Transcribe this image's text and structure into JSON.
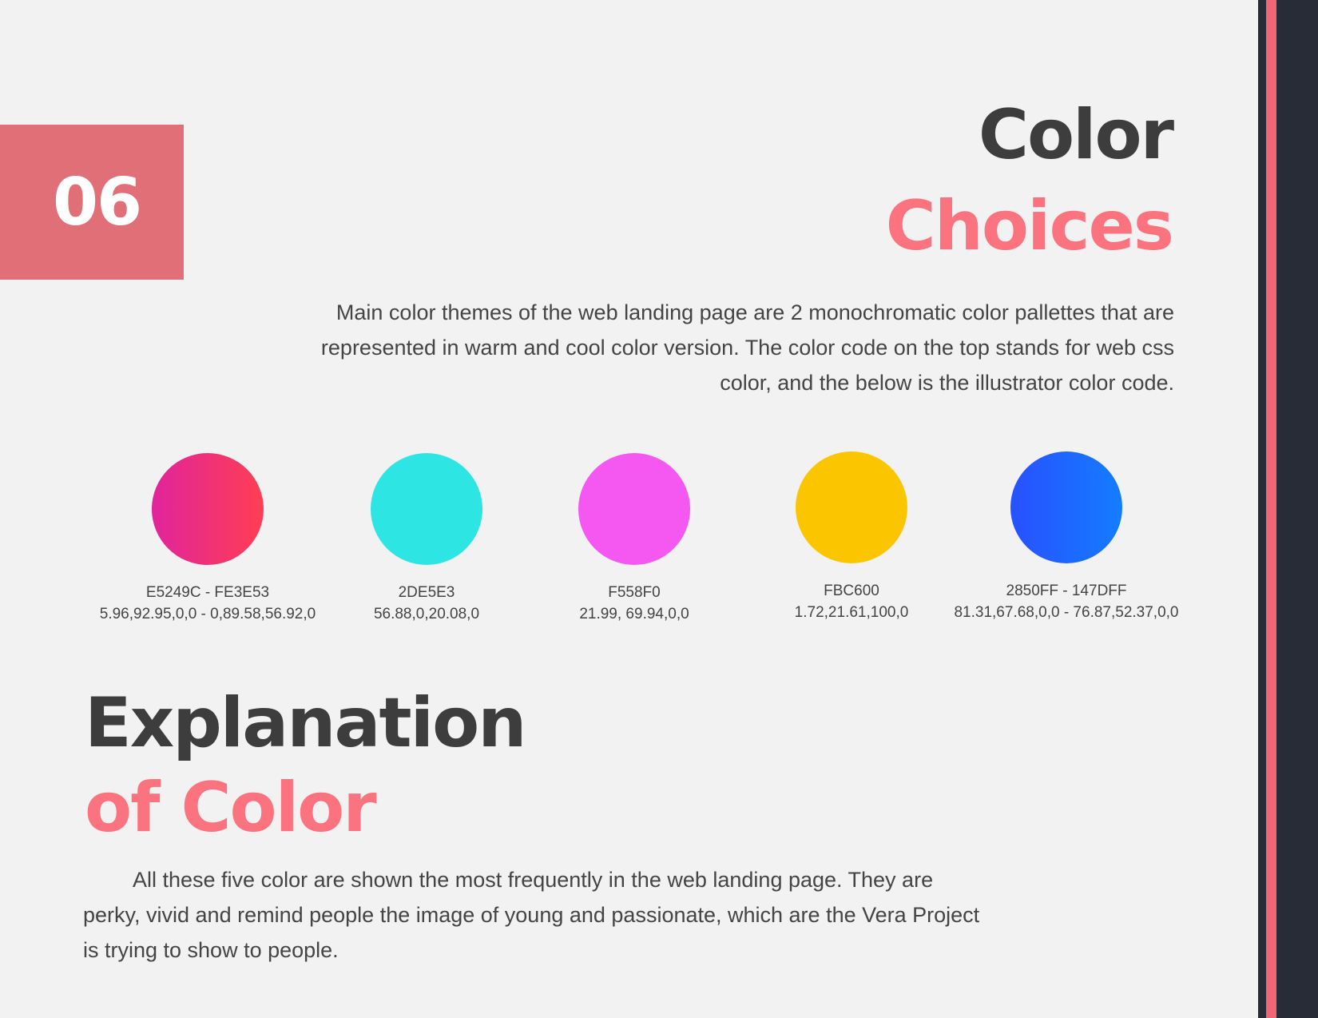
{
  "page_number": "06",
  "header": {
    "title_line1": "Color",
    "title_line2": "Choices"
  },
  "intro": "Main color themes of the web landing page are 2 monochromatic color pallettes that are represented in warm and cool color version. The color code on the top stands for web css color, and the below is the illustrator color code.",
  "swatches": [
    {
      "hex": "E5249C - FE3E53",
      "cmyk": "5.96,92.95,0,0 - 0,89.58,56.92,0",
      "colors": [
        "#E0249C",
        "#FE3E53"
      ]
    },
    {
      "hex": "2DE5E3",
      "cmyk": "56.88,0,20.08,0",
      "colors": [
        "#2DE5E3"
      ]
    },
    {
      "hex": "F558F0",
      "cmyk": "21.99, 69.94,0,0",
      "colors": [
        "#F558F0"
      ]
    },
    {
      "hex": "FBC600",
      "cmyk": "1.72,21.61,100,0",
      "colors": [
        "#FBC600"
      ]
    },
    {
      "hex": "2850FF - 147DFF",
      "cmyk": "81.31,67.68,0,0 - 76.87,52.37,0,0",
      "colors": [
        "#2850FF",
        "#147DFF"
      ]
    }
  ],
  "explanation": {
    "title_line1": "Explanation",
    "title_line2": "of Color",
    "body": "All these five color are shown the most frequently in the web landing page. They are perky, vivid and remind people the image of young and passionate, which are the Vera Project is trying to show to people."
  },
  "colors": {
    "background": "#F2F2F2",
    "accent_pink": "#FA737F",
    "number_box": "#E06F78",
    "sidebar_dark": "#272C36",
    "sidebar_pink": "#EF6677",
    "heading_dark": "#3D3D3D"
  }
}
